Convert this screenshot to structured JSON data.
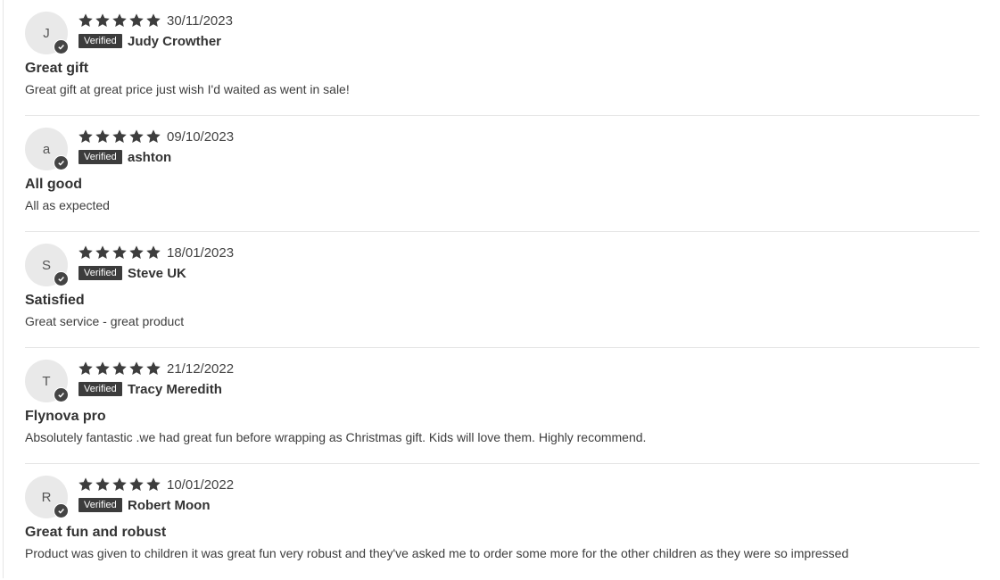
{
  "badge_label": "Verified",
  "reviews": [
    {
      "initial": "J",
      "rating": 5,
      "date": "30/11/2023",
      "name": "Judy Crowther",
      "title": "Great gift",
      "body": "Great gift at great price just wish I'd waited as went in sale!"
    },
    {
      "initial": "a",
      "rating": 5,
      "date": "09/10/2023",
      "name": "ashton",
      "title": "All good",
      "body": "All as expected"
    },
    {
      "initial": "S",
      "rating": 5,
      "date": "18/01/2023",
      "name": "Steve UK",
      "title": "Satisfied",
      "body": "Great service - great product"
    },
    {
      "initial": "T",
      "rating": 5,
      "date": "21/12/2022",
      "name": "Tracy Meredith",
      "title": "Flynova pro",
      "body": "Absolutely fantastic .we had great fun before wrapping as Christmas gift. Kids will love them. Highly recommend."
    },
    {
      "initial": "R",
      "rating": 5,
      "date": "10/01/2022",
      "name": "Robert Moon",
      "title": "Great fun and robust",
      "body": "Product was given to children it was great fun very robust and they've asked me to order some more for the other children as they were so impressed"
    }
  ]
}
